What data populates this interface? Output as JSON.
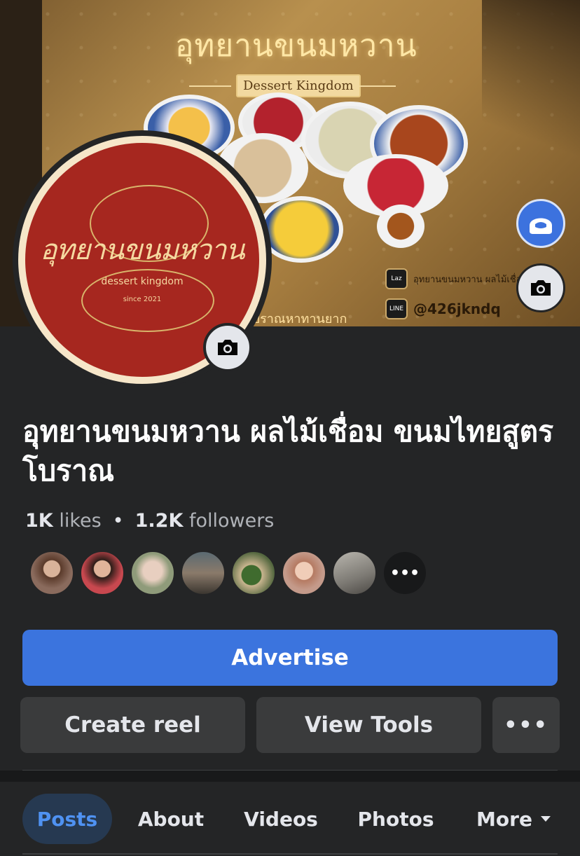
{
  "cover": {
    "title": "อุทยานขนมหวาน",
    "subtitle": "Dessert Kingdom",
    "shop_handle_text": "อุทยานขนมหวาน ผลไม้เชื่อม โบรา",
    "lazada_badge": "Laz",
    "line_badge": "LINE",
    "line_id": "@426jkndq",
    "strip_text": "โบราณหาทานยาก"
  },
  "avatar": {
    "logo_text": "อุทยานขนมหวาน",
    "logo_sub": "dessert kingdom",
    "logo_since": "since 2021"
  },
  "page": {
    "name": "อุทยานขนมหวาน ผลไม้เชื่อม ขนมไทยสูตรโบราณ",
    "likes_count": "1K",
    "likes_label": "likes",
    "followers_count": "1.2K",
    "followers_label": "followers",
    "separator": "•"
  },
  "likers": {
    "more_label": "•••",
    "colors": [
      "#8a6b5d",
      "#c8484f",
      "#8f9b7a",
      "#6b6a64",
      "#54673f",
      "#c49a8a",
      "#7d7a74"
    ]
  },
  "actions": {
    "advertise": "Advertise",
    "create_reel": "Create reel",
    "view_tools": "View Tools",
    "more": "•••"
  },
  "tabs": {
    "posts": "Posts",
    "about": "About",
    "videos": "Videos",
    "photos": "Photos",
    "more": "More"
  },
  "colors": {
    "background": "#242526",
    "accent_blue": "#3b74de",
    "active_tab_bg": "#263951",
    "active_tab_text": "#4f92f2",
    "avatar_red": "#a6271f"
  }
}
